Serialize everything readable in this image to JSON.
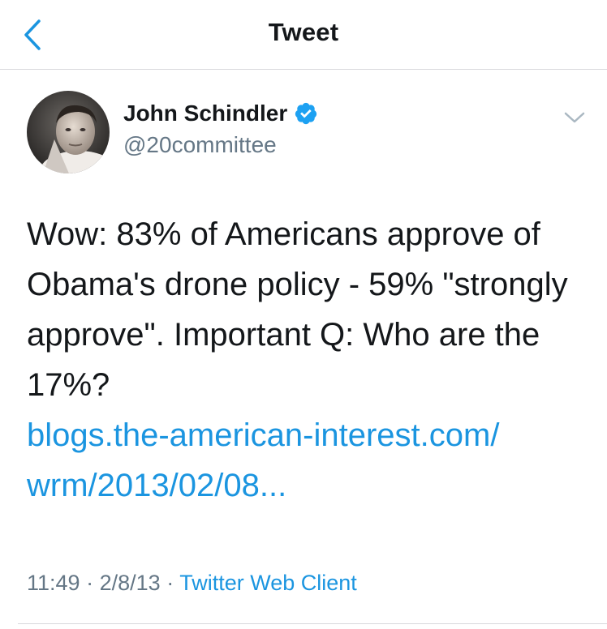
{
  "nav": {
    "title": "Tweet",
    "back_icon": "chevron-left-icon"
  },
  "author": {
    "name": "John Schindler",
    "handle": "@20committee",
    "verified": true,
    "verified_icon": "verified-badge-icon"
  },
  "tweet": {
    "text_lines": [
      "Wow: 83% of Americans approve of",
      "Obama's drone policy - 59% \"strongly",
      "approve\". Important Q: Who are the",
      "17%?"
    ],
    "link_lines": [
      "blogs.the-american-interest.com/",
      "wrm/2013/02/08..."
    ]
  },
  "meta": {
    "time": "11:49",
    "separator": "·",
    "date": "2/8/13",
    "source": "Twitter Web Client"
  },
  "colors": {
    "accent": "#1b95e0",
    "secondary_text": "#657786",
    "primary_text": "#14171a",
    "divider": "#d8d8dc"
  }
}
